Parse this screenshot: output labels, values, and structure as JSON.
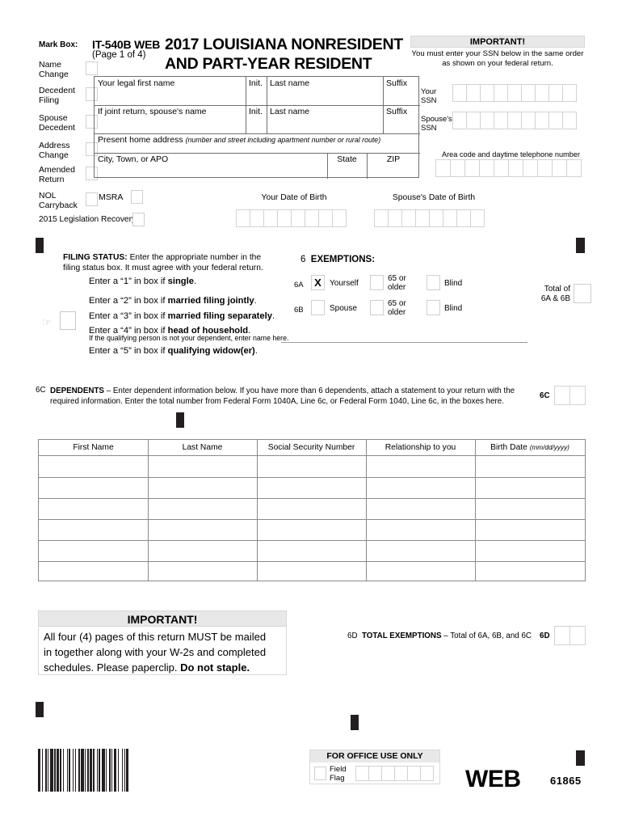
{
  "form": {
    "number": "IT-540B WEB",
    "page_of": "(Page 1 of 4)",
    "title_line1": "2017 LOUISIANA NONRESIDENT",
    "title_line2": "AND PART-YEAR RESIDENT",
    "web_word": "WEB",
    "form_code": "61865"
  },
  "mark_box": {
    "title": "Mark Box:",
    "items": [
      {
        "label_line1": "Name",
        "label_line2": "Change"
      },
      {
        "label_line1": "Decedent",
        "label_line2": "Filing"
      },
      {
        "label_line1": "Spouse",
        "label_line2": "Decedent"
      },
      {
        "label_line1": "Address",
        "label_line2": "Change"
      },
      {
        "label_line1": "Amended",
        "label_line2": "Return"
      },
      {
        "label_line1": "NOL",
        "label_line2": "Carryback"
      }
    ],
    "msra_label": "MSRA",
    "legislation_recovery_label": "2015 Legislation Recovery"
  },
  "name_grid": {
    "your_first_name": "Your legal first name",
    "init": "Init.",
    "last_name": "Last name",
    "suffix": "Suffix",
    "spouse_name": "If joint return, spouse's name",
    "spouse_init": "Init.",
    "spouse_last_name": "Last name",
    "spouse_suffix": "Suffix",
    "address": "Present home address",
    "address_note": "(number and street including apartment number or rural route)",
    "city": "City, Town, or APO",
    "state": "State",
    "zip": "ZIP"
  },
  "ssn_panel": {
    "header": "IMPORTANT!",
    "text": "You must enter your SSN below in the same order as shown on your federal return.",
    "your_ssn_label_line1": "Your",
    "your_ssn_label_line2": "SSN",
    "spouse_ssn_label_line1": "Spouse's",
    "spouse_ssn_label_line2": "SSN",
    "ssn_box_count": 9,
    "phone_label": "Area code and daytime telephone number",
    "phone_box_count": 10
  },
  "dob": {
    "your_label": "Your Date of Birth",
    "spouse_label": "Spouse's Date of Birth",
    "box_count": 8
  },
  "filing_status": {
    "heading_bold": "FILING STATUS:",
    "heading_rest": " Enter the appropriate number in the",
    "heading_line2": "filing status box. It must agree with your federal return.",
    "options": [
      {
        "prefix": "Enter a “1” in box if ",
        "bold": "single",
        "suffix": "."
      },
      {
        "prefix": "Enter a “2” in box if ",
        "bold": "married filing jointly",
        "suffix": "."
      },
      {
        "prefix": "Enter a “3” in box if ",
        "bold": "married filing separately",
        "suffix": "."
      },
      {
        "prefix": "Enter a “4” in box if ",
        "bold": "head of household",
        "suffix": "."
      },
      {
        "prefix": "Enter a “5” in box if ",
        "bold": "qualifying widow(er)",
        "suffix": "."
      }
    ],
    "subnote": "If the qualifying person is not your dependent, enter name here.",
    "box_value": ""
  },
  "exemptions": {
    "number": "6",
    "title": "EXEMPTIONS:",
    "row_a": {
      "code": "6A",
      "self_label": "Yourself",
      "self_checked": "X",
      "age_label_line1": "65 or",
      "age_label_line2": "older",
      "blind_label": "Blind"
    },
    "row_b": {
      "code": "6B",
      "spouse_label": "Spouse",
      "spouse_checked": "",
      "age_label_line1": "65 or",
      "age_label_line2": "older",
      "blind_label": "Blind"
    },
    "total_label_line1": "Total of",
    "total_label_line2": "6A & 6B",
    "total_value": ""
  },
  "dependents": {
    "number": "6C",
    "text_bold": "DEPENDENTS",
    "text_line1": " – Enter dependent information below. If you have more than 6 dependents, attach a statement to your return with the",
    "text_line2": "required information. Enter the total number from Federal Form 1040A, Line 6c, or Federal Form 1040, Line 6c, in the boxes here.",
    "right_code": "6C",
    "columns": [
      "First Name",
      "Last Name",
      "Social Security Number",
      "Relationship to you",
      "Birth Date"
    ],
    "birthdate_note": "(mm/dd/yyyy)",
    "rows": [
      {
        "first_name": "",
        "last_name": "",
        "ssn": "",
        "relationship": "",
        "birth_date": ""
      },
      {
        "first_name": "",
        "last_name": "",
        "ssn": "",
        "relationship": "",
        "birth_date": ""
      },
      {
        "first_name": "",
        "last_name": "",
        "ssn": "",
        "relationship": "",
        "birth_date": ""
      },
      {
        "first_name": "",
        "last_name": "",
        "ssn": "",
        "relationship": "",
        "birth_date": ""
      },
      {
        "first_name": "",
        "last_name": "",
        "ssn": "",
        "relationship": "",
        "birth_date": ""
      },
      {
        "first_name": "",
        "last_name": "",
        "ssn": "",
        "relationship": "",
        "birth_date": ""
      }
    ]
  },
  "important_notice": {
    "header": "IMPORTANT!",
    "line1": "All four (4) pages of this return MUST be mailed",
    "line2": "in together along with your W-2s and completed",
    "line3_normal": "schedules.  Please paperclip.  ",
    "line3_bold": "Do not staple."
  },
  "total_exemptions": {
    "number": "6D",
    "label_bold": "TOTAL EXEMPTIONS",
    "label_rest": " – Total of 6A, 6B, and 6C",
    "right_code": "6D",
    "value": ""
  },
  "office_use": {
    "header": "FOR OFFICE USE ONLY",
    "field_label_line1": "Field",
    "field_label_line2": "Flag",
    "box_count": 6
  },
  "colors": {
    "panel_gray": "#e8e8e8",
    "line_gray": "#8a8a8a",
    "box_gray": "#cfcfcf",
    "reg_mark": "#231f20"
  }
}
